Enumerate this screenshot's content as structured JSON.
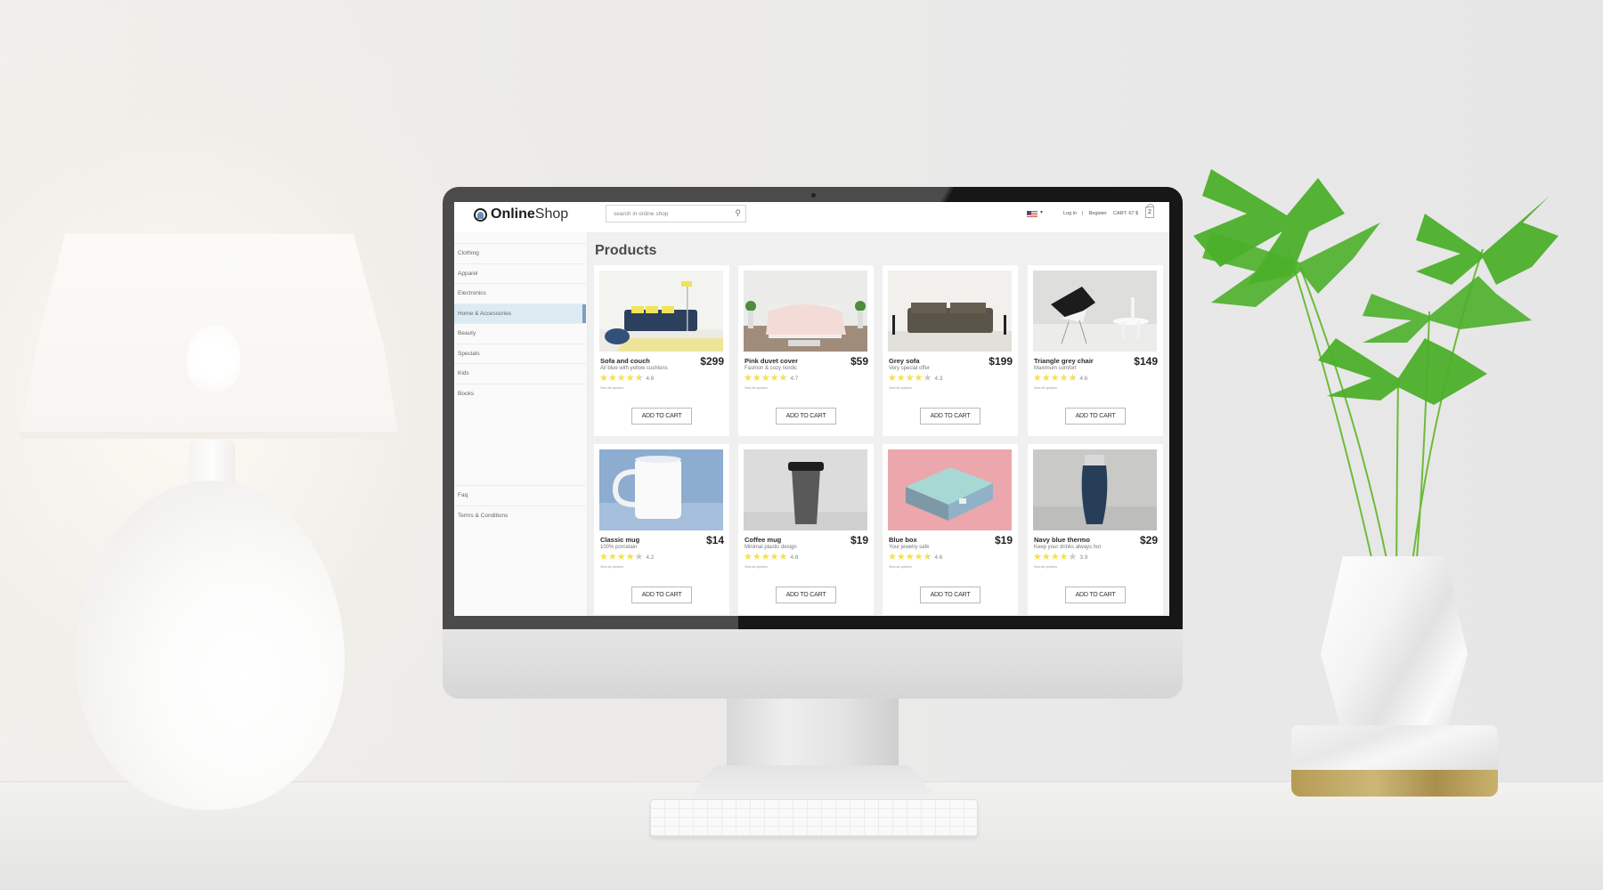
{
  "app": {
    "logo_bold": "Online",
    "logo_light": "Shop"
  },
  "header": {
    "search_placeholder": "search in online shop",
    "language": "US",
    "login_label": "Log in",
    "separator": "|",
    "register_label": "Register",
    "cart_label": "CART: 67 $",
    "cart_count": "2"
  },
  "sidebar": {
    "items": [
      {
        "label": "Clothing",
        "active": false
      },
      {
        "label": "Apparel",
        "active": false
      },
      {
        "label": "Electronics",
        "active": false
      },
      {
        "label": "Home & Accessories",
        "active": true
      },
      {
        "label": "Beauty",
        "active": false
      },
      {
        "label": "Specials",
        "active": false
      },
      {
        "label": "Kids",
        "active": false
      },
      {
        "label": "Books",
        "active": false
      }
    ],
    "footer_items": [
      {
        "label": "Faq"
      },
      {
        "label": "Terms & Conditions"
      }
    ]
  },
  "main": {
    "title": "Products",
    "products": [
      {
        "name": "Sofa and couch",
        "desc": "All blue with yellow cushions",
        "price": "$299",
        "rating": "4.6",
        "stars": 4.6,
        "opinions": "View all opinions",
        "button": "ADD TO CART",
        "image": "sofa"
      },
      {
        "name": "Pink duvet cover",
        "desc": "Fashion & cozy nordic",
        "price": "$59",
        "rating": "4.7",
        "stars": 4.7,
        "opinions": "View all opinions",
        "button": "ADD TO CART",
        "image": "bed"
      },
      {
        "name": "Grey sofa",
        "desc": "Very special offer",
        "price": "$199",
        "rating": "4.3",
        "stars": 4.3,
        "opinions": "View all opinions",
        "button": "ADD TO CART",
        "image": "greysofa"
      },
      {
        "name": "Triangle grey chair",
        "desc": "Maximum comfort",
        "price": "$149",
        "rating": "4.6",
        "stars": 4.6,
        "opinions": "View all opinions",
        "button": "ADD TO CART",
        "image": "chair"
      },
      {
        "name": "Classic mug",
        "desc": "100% porcelain",
        "price": "$14",
        "rating": "4.2",
        "stars": 4.2,
        "opinions": "View all opinions",
        "button": "ADD TO CART",
        "image": "mug"
      },
      {
        "name": "Coffee mug",
        "desc": "Minimal plastic design",
        "price": "$19",
        "rating": "4.8",
        "stars": 4.8,
        "opinions": "View all opinions",
        "button": "ADD TO CART",
        "image": "cup"
      },
      {
        "name": "Blue box",
        "desc": "Your jewelry safe",
        "price": "$19",
        "rating": "4.6",
        "stars": 4.6,
        "opinions": "View all opinions",
        "button": "ADD TO CART",
        "image": "box"
      },
      {
        "name": "Navy blue thermo",
        "desc": "Keep your drinks always hot",
        "price": "$29",
        "rating": "3.9",
        "stars": 3.9,
        "opinions": "View all opinions",
        "button": "ADD TO CART",
        "image": "thermo"
      }
    ]
  },
  "colors": {
    "star_filled": "#f5e04a",
    "star_empty": "#c9c9c9",
    "active_nav_bg": "#dcebf3",
    "active_nav_bar": "#7e9fbd"
  }
}
